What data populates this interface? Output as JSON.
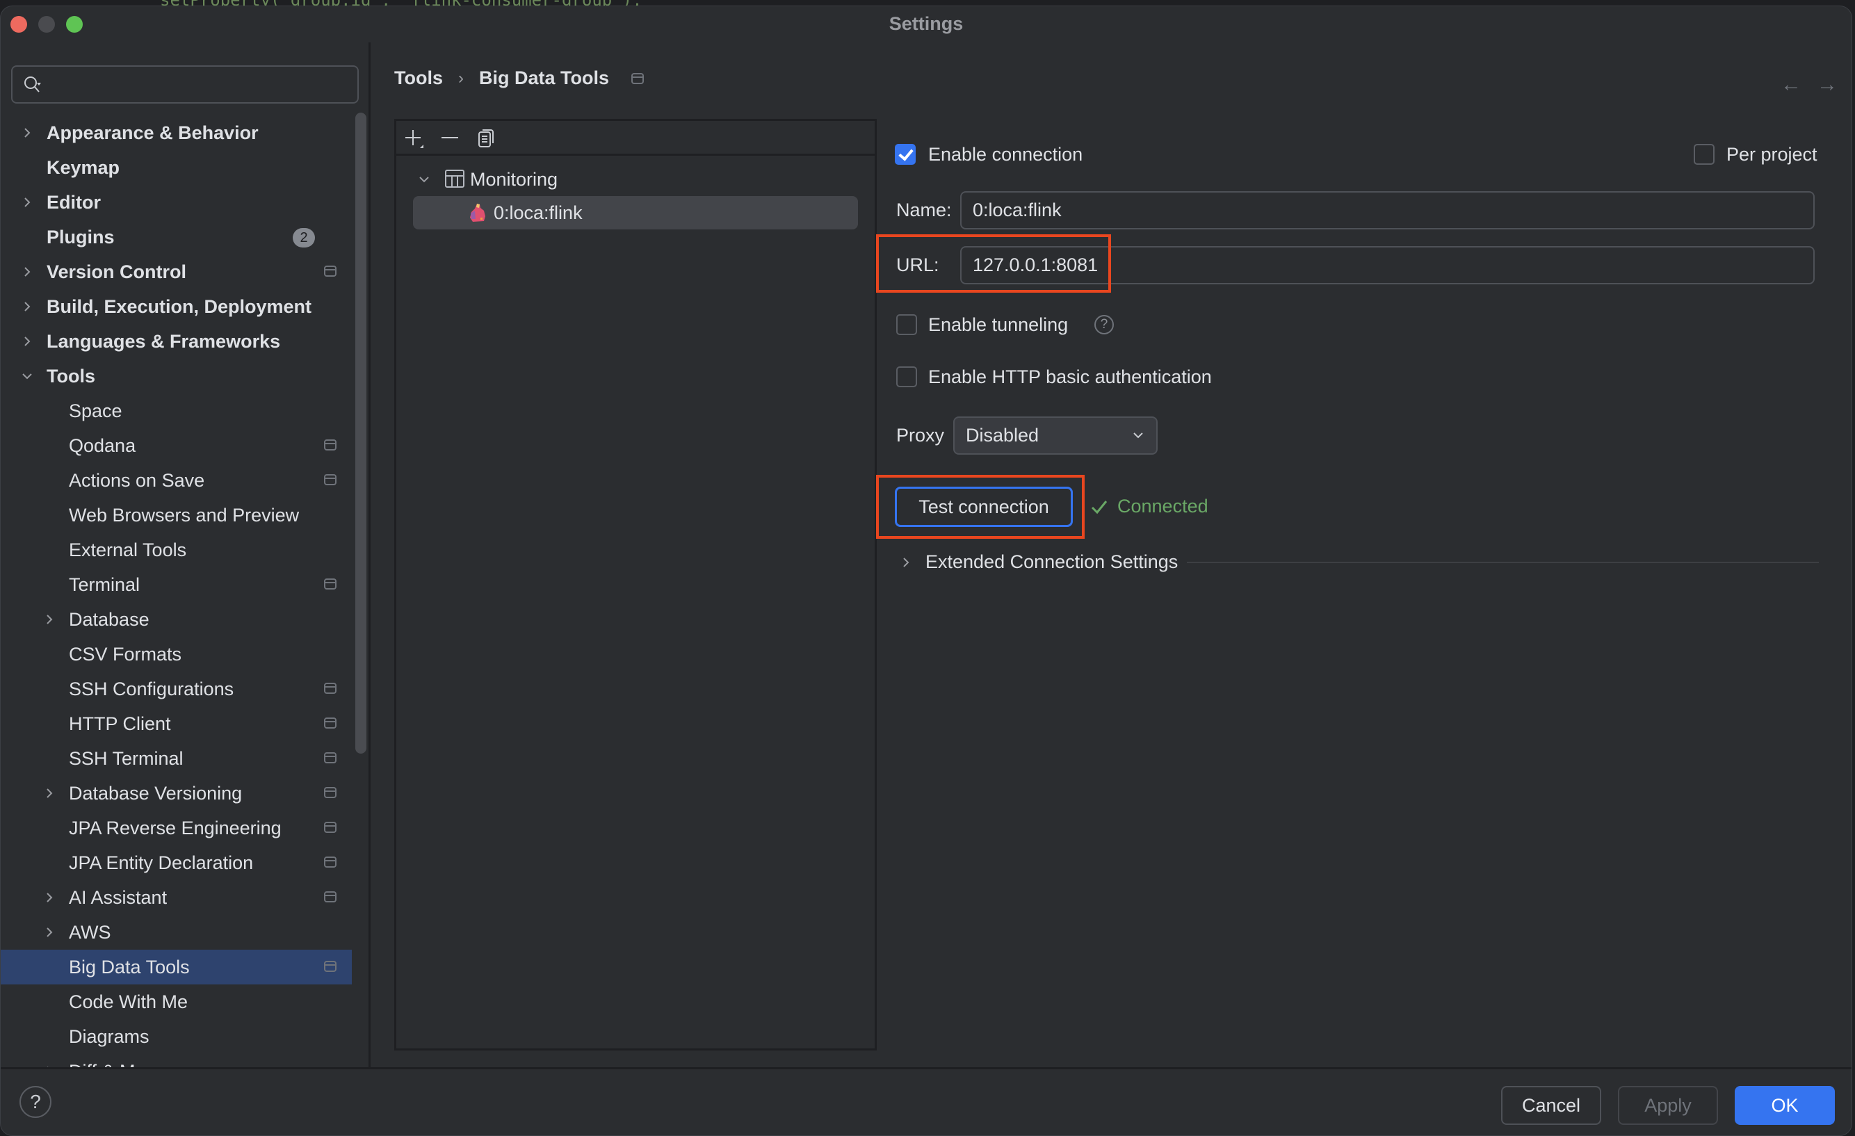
{
  "background_code": "setProperty(\"group.id\", \"flink-consumer-group\");",
  "window": {
    "title": "Settings"
  },
  "search": {
    "value": "",
    "placeholder": ""
  },
  "sidebar": {
    "items": [
      {
        "label": "Appearance & Behavior",
        "level": 0,
        "expandable": true,
        "expanded": false
      },
      {
        "label": "Keymap",
        "level": 0,
        "expandable": false
      },
      {
        "label": "Editor",
        "level": 0,
        "expandable": true,
        "expanded": false
      },
      {
        "label": "Plugins",
        "level": 0,
        "expandable": false,
        "badge": "2"
      },
      {
        "label": "Version Control",
        "level": 0,
        "expandable": true,
        "expanded": false,
        "project_icon": true
      },
      {
        "label": "Build, Execution, Deployment",
        "level": 0,
        "expandable": true,
        "expanded": false
      },
      {
        "label": "Languages & Frameworks",
        "level": 0,
        "expandable": true,
        "expanded": false
      },
      {
        "label": "Tools",
        "level": 0,
        "expandable": true,
        "expanded": true
      },
      {
        "label": "Space",
        "level": 1
      },
      {
        "label": "Qodana",
        "level": 1,
        "project_icon": true
      },
      {
        "label": "Actions on Save",
        "level": 1,
        "project_icon": true
      },
      {
        "label": "Web Browsers and Preview",
        "level": 1
      },
      {
        "label": "External Tools",
        "level": 1
      },
      {
        "label": "Terminal",
        "level": 1,
        "project_icon": true
      },
      {
        "label": "Database",
        "level": 1,
        "expandable": true,
        "expanded": false
      },
      {
        "label": "CSV Formats",
        "level": 1
      },
      {
        "label": "SSH Configurations",
        "level": 1,
        "project_icon": true
      },
      {
        "label": "HTTP Client",
        "level": 1,
        "project_icon": true
      },
      {
        "label": "SSH Terminal",
        "level": 1,
        "project_icon": true
      },
      {
        "label": "Database Versioning",
        "level": 1,
        "expandable": true,
        "expanded": false,
        "project_icon": true
      },
      {
        "label": "JPA Reverse Engineering",
        "level": 1,
        "project_icon": true
      },
      {
        "label": "JPA Entity Declaration",
        "level": 1,
        "project_icon": true
      },
      {
        "label": "AI Assistant",
        "level": 1,
        "expandable": true,
        "expanded": false,
        "project_icon": true
      },
      {
        "label": "AWS",
        "level": 1,
        "expandable": true,
        "expanded": false
      },
      {
        "label": "Big Data Tools",
        "level": 1,
        "selected": true,
        "project_icon": true
      },
      {
        "label": "Code With Me",
        "level": 1
      },
      {
        "label": "Diagrams",
        "level": 1
      },
      {
        "label": "Diff & Merge",
        "level": 1,
        "expandable": true,
        "expanded": false
      }
    ]
  },
  "breadcrumb": {
    "parent": "Tools",
    "separator": "›",
    "current": "Big Data Tools"
  },
  "nav": {
    "back": "←",
    "forward": "→"
  },
  "connections": {
    "toolbar": {
      "add": "add-icon",
      "remove": "remove-icon",
      "copy": "copy-icon"
    },
    "tree": {
      "group": {
        "label": "Monitoring",
        "expanded": true
      },
      "items": [
        {
          "label": "0:loca:flink",
          "selected": true
        }
      ]
    }
  },
  "form": {
    "enable_connection": {
      "label": "Enable connection",
      "checked": true
    },
    "per_project": {
      "label": "Per project",
      "checked": false
    },
    "name": {
      "label": "Name:",
      "value": "0:loca:flink"
    },
    "url": {
      "label": "URL:",
      "value": "127.0.0.1:8081"
    },
    "enable_tunneling": {
      "label": "Enable tunneling",
      "checked": false,
      "help": "?"
    },
    "http_auth": {
      "label": "Enable HTTP basic authentication",
      "checked": false
    },
    "proxy": {
      "label": "Proxy",
      "value": "Disabled"
    },
    "test_connection": {
      "label": "Test connection"
    },
    "status": {
      "text": "Connected",
      "color": "#6aa866"
    },
    "extended": {
      "label": "Extended Connection Settings",
      "expanded": false
    }
  },
  "footer": {
    "help": "?",
    "cancel": "Cancel",
    "apply": "Apply",
    "ok": "OK"
  },
  "colors": {
    "accent": "#3574f0",
    "selection": "#2e436e",
    "annotation": "#e8461f",
    "success": "#6aa866"
  }
}
